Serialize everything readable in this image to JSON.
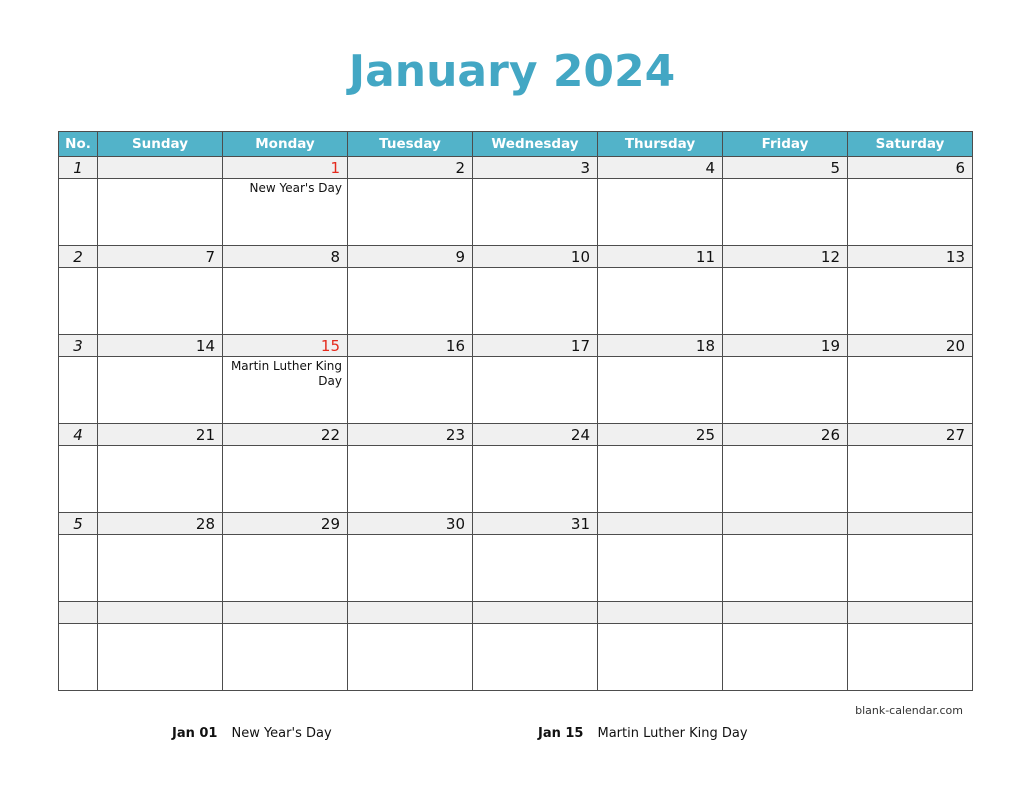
{
  "title": "January 2024",
  "colors": {
    "header_background": "#52B3C9",
    "title_text": "#43A7C4",
    "holiday_text": "#E42A1D",
    "date_row_background": "#F0F0F0",
    "grid_border": "#4D4D4D"
  },
  "table": {
    "headers": [
      "No.",
      "Sunday",
      "Monday",
      "Tuesday",
      "Wednesday",
      "Thursday",
      "Friday",
      "Saturday"
    ],
    "weeks": [
      {
        "number": "1",
        "days": [
          {
            "date": "",
            "note": "",
            "holiday": false
          },
          {
            "date": "1",
            "note": "New Year's Day",
            "holiday": true
          },
          {
            "date": "2",
            "note": "",
            "holiday": false
          },
          {
            "date": "3",
            "note": "",
            "holiday": false
          },
          {
            "date": "4",
            "note": "",
            "holiday": false
          },
          {
            "date": "5",
            "note": "",
            "holiday": false
          },
          {
            "date": "6",
            "note": "",
            "holiday": false
          }
        ]
      },
      {
        "number": "2",
        "days": [
          {
            "date": "7",
            "note": "",
            "holiday": false
          },
          {
            "date": "8",
            "note": "",
            "holiday": false
          },
          {
            "date": "9",
            "note": "",
            "holiday": false
          },
          {
            "date": "10",
            "note": "",
            "holiday": false
          },
          {
            "date": "11",
            "note": "",
            "holiday": false
          },
          {
            "date": "12",
            "note": "",
            "holiday": false
          },
          {
            "date": "13",
            "note": "",
            "holiday": false
          }
        ]
      },
      {
        "number": "3",
        "days": [
          {
            "date": "14",
            "note": "",
            "holiday": false
          },
          {
            "date": "15",
            "note": "Martin Luther King Day",
            "holiday": true
          },
          {
            "date": "16",
            "note": "",
            "holiday": false
          },
          {
            "date": "17",
            "note": "",
            "holiday": false
          },
          {
            "date": "18",
            "note": "",
            "holiday": false
          },
          {
            "date": "19",
            "note": "",
            "holiday": false
          },
          {
            "date": "20",
            "note": "",
            "holiday": false
          }
        ]
      },
      {
        "number": "4",
        "days": [
          {
            "date": "21",
            "note": "",
            "holiday": false
          },
          {
            "date": "22",
            "note": "",
            "holiday": false
          },
          {
            "date": "23",
            "note": "",
            "holiday": false
          },
          {
            "date": "24",
            "note": "",
            "holiday": false
          },
          {
            "date": "25",
            "note": "",
            "holiday": false
          },
          {
            "date": "26",
            "note": "",
            "holiday": false
          },
          {
            "date": "27",
            "note": "",
            "holiday": false
          }
        ]
      },
      {
        "number": "5",
        "days": [
          {
            "date": "28",
            "note": "",
            "holiday": false
          },
          {
            "date": "29",
            "note": "",
            "holiday": false
          },
          {
            "date": "30",
            "note": "",
            "holiday": false
          },
          {
            "date": "31",
            "note": "",
            "holiday": false
          },
          {
            "date": "",
            "note": "",
            "holiday": false
          },
          {
            "date": "",
            "note": "",
            "holiday": false
          },
          {
            "date": "",
            "note": "",
            "holiday": false
          }
        ]
      },
      {
        "number": "",
        "days": [
          {
            "date": "",
            "note": "",
            "holiday": false
          },
          {
            "date": "",
            "note": "",
            "holiday": false
          },
          {
            "date": "",
            "note": "",
            "holiday": false
          },
          {
            "date": "",
            "note": "",
            "holiday": false
          },
          {
            "date": "",
            "note": "",
            "holiday": false
          },
          {
            "date": "",
            "note": "",
            "holiday": false
          },
          {
            "date": "",
            "note": "",
            "holiday": false
          }
        ]
      }
    ]
  },
  "legend": [
    {
      "date": "Jan 01",
      "name": "New Year's Day"
    },
    {
      "date": "Jan 15",
      "name": "Martin Luther King Day"
    }
  ],
  "watermark": "blank-calendar.com"
}
